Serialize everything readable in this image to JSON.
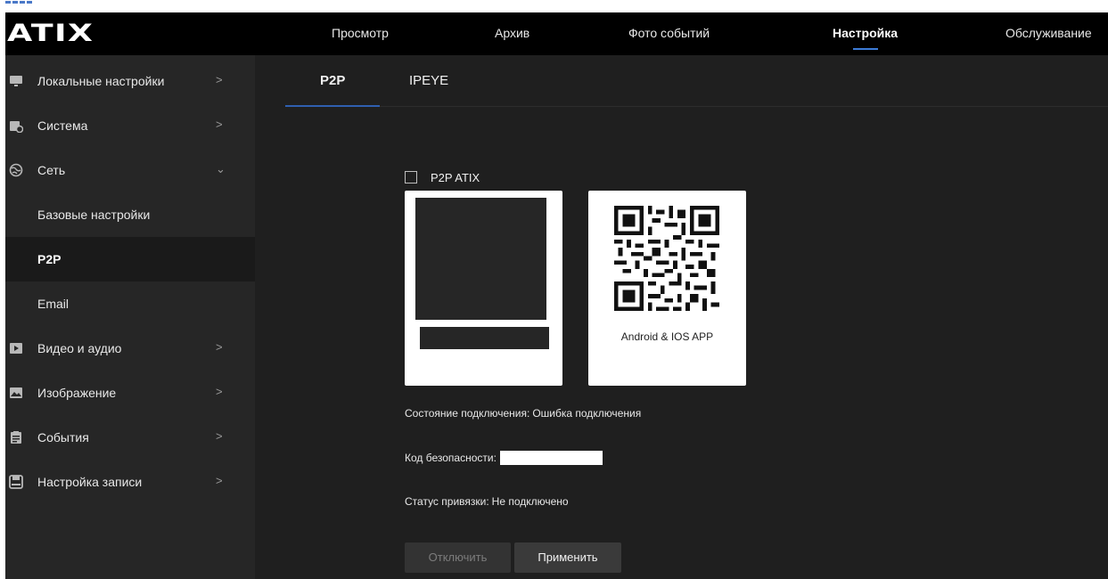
{
  "app": {
    "logo": "ATIX"
  },
  "nav": {
    "items": [
      {
        "label": "Просмотр"
      },
      {
        "label": "Архив"
      },
      {
        "label": "Фото событий"
      },
      {
        "label": "Настройка",
        "active": true
      },
      {
        "label": "Обслуживание"
      }
    ]
  },
  "sidebar": {
    "items": [
      {
        "label": "Локальные настройки",
        "icon": "monitor-icon",
        "chevron": ">"
      },
      {
        "label": "Система",
        "icon": "system-icon",
        "chevron": ">"
      },
      {
        "label": "Сеть",
        "icon": "network-globe-icon",
        "chevron": "⌄"
      },
      {
        "label": "Базовые настройки"
      },
      {
        "label": "P2P",
        "selected": true
      },
      {
        "label": "Email"
      },
      {
        "label": "Видео и аудио",
        "icon": "video-icon",
        "chevron": ">"
      },
      {
        "label": "Изображение",
        "icon": "image-icon",
        "chevron": ">"
      },
      {
        "label": "События",
        "icon": "events-icon",
        "chevron": ">"
      },
      {
        "label": "Настройка записи",
        "icon": "record-icon",
        "chevron": ">"
      }
    ]
  },
  "tabs": [
    {
      "label": "P2P",
      "active": true
    },
    {
      "label": "IPEYE"
    }
  ],
  "p2p": {
    "checkbox_label": "P2P ATIX",
    "checked": false,
    "app_label": "Android & IOS APP",
    "connection_label": "Состояние подключения:",
    "connection_value": "Ошибка подключения",
    "security_label": "Код безопасности:",
    "binding_label": "Статус привязки:",
    "binding_value": "Не подключено",
    "disconnect_button": "Отключить",
    "apply_button": "Применить"
  },
  "colors": {
    "accent": "#3c7bd6",
    "header_bg": "#000000",
    "sidebar_bg": "#262626",
    "main_bg": "#1f1f1f"
  }
}
